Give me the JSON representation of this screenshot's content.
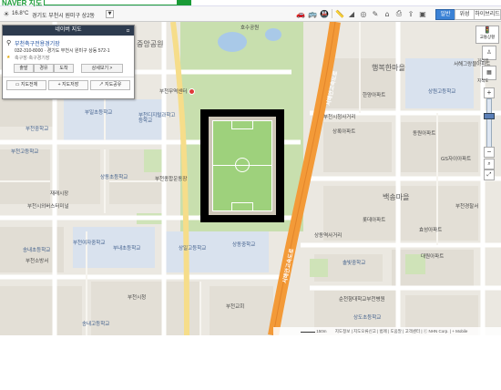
{
  "header": {
    "logo": "NAVER 지도",
    "weather": "16.8°C",
    "location_path": "경기도 부천시 원미구 상2동"
  },
  "toolbar": {
    "tabs": [
      "일반",
      "위성",
      "하이브리드"
    ],
    "active_tab": "일반"
  },
  "panel": {
    "title": "네이버 지도",
    "place_name": "부천축구전용경기장",
    "phone_address": "032-310-8000 · 경기도 부천시 원미구 상동 572-1",
    "category": "축구장·축구경기장",
    "actions": [
      "출발",
      "경유",
      "도착",
      "상세보기 >"
    ],
    "tools": [
      "지도전체",
      "지도저장",
      "지도공유"
    ]
  },
  "map_labels": {
    "park": "중앙공원",
    "lake_park": "호수공원",
    "trade_center": "부천무역센터",
    "road_main": "서해안고속도로",
    "road_main2": "서해안고속도로",
    "dong_haengbok": "행복한마을",
    "dong_baeksong": "백송마을",
    "school_1": "부일초등학교",
    "school_2": "부천디지털과학고등학교",
    "school_3": "부천고등학교",
    "school_4": "부천중학교",
    "school_5": "상일고등학교",
    "school_6": "상동중학교",
    "school_7": "부내초등학교",
    "school_8": "송내고등학교",
    "school_9": "상도초등학교",
    "school_10": "상원고등학교",
    "school_11": "부천여자중학교",
    "school_12": "송내초등학교",
    "school_13": "솔빛중학교",
    "school_14": "상동초등학교",
    "apt_1": "한양아파트",
    "apt_2": "서해그랑블아파트",
    "apt_3": "동원아파트",
    "apt_4": "상록아파트",
    "apt_5": "롯데아파트",
    "apt_6": "효성아파트",
    "apt_7": "GS자이아파트",
    "apt_8": "대원아파트",
    "bus_terminal": "부천시외버스터미널",
    "city_hall": "부천시청",
    "fire_station": "부천소방서",
    "church": "부천교회",
    "hospital": "순천향대학교부천병원",
    "cross_1": "부천시청사거리",
    "cross_2": "상동역사거리",
    "market": "재래시장",
    "police": "부천경찰서",
    "stadium": "부천종합운동장"
  },
  "status": {
    "scale": "150m",
    "links": "지도정보 | 지도오류신고 | 범례 | 도움말 | 고객센터 | ⓒ NHN Corp. | + Mobile"
  },
  "controls": {
    "traffic": "교통상황",
    "zoom_in": "+",
    "zoom_out": "−",
    "street": "거리뷰",
    "cadastral": "지적도"
  }
}
